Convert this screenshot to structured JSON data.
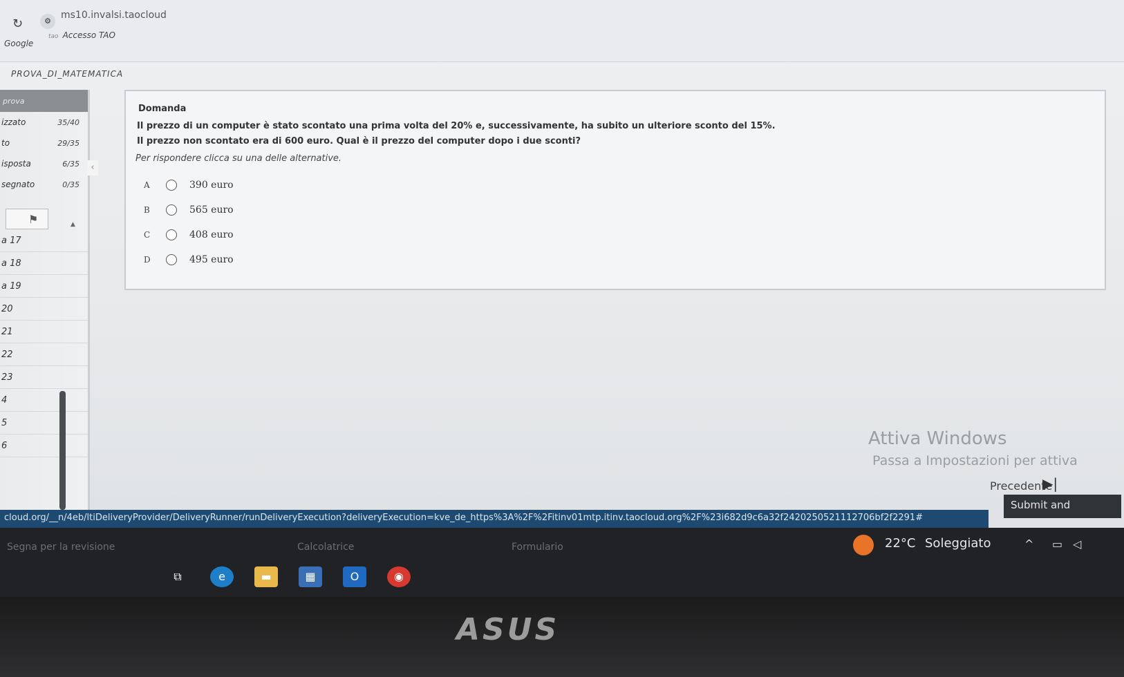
{
  "browser": {
    "url": "ms10.invalsi.taocloud",
    "bookmarks": [
      {
        "label": "Google"
      },
      {
        "label": "Accesso TAO",
        "icon_text": "tao"
      }
    ]
  },
  "app": {
    "title": "PROVA_DI_MATEMATICA"
  },
  "sidebar": {
    "header": "prova",
    "stats": [
      {
        "label": "izzato",
        "value": "35/40"
      },
      {
        "label": "to",
        "value": "29/35"
      },
      {
        "label": "isposta",
        "value": "6/35"
      },
      {
        "label": "segnato",
        "value": "0/35"
      }
    ],
    "items": [
      "a 17",
      "a 18",
      "a 19",
      "20",
      "21",
      "22",
      "23",
      "4",
      "5",
      "6"
    ]
  },
  "question": {
    "label": "Domanda",
    "text_line1": "Il prezzo di un computer è stato scontato una prima volta del 20% e, successivamente, ha subito un ulteriore sconto del 15%.",
    "text_line2": "Il prezzo non scontato era di 600 euro. Qual è il prezzo del computer dopo i due sconti?",
    "instruction": "Per rispondere clicca su una delle alternative.",
    "options": [
      {
        "letter": "A",
        "text": "390 euro"
      },
      {
        "letter": "B",
        "text": "565 euro"
      },
      {
        "letter": "C",
        "text": "408 euro"
      },
      {
        "letter": "D",
        "text": "495 euro"
      }
    ]
  },
  "watermark": {
    "title": "Attiva Windows",
    "subtitle": "Passa a Impostazioni per attiva"
  },
  "status_url": "cloud.org/__n/4eb/ltiDeliveryProvider/DeliveryRunner/runDeliveryExecution?deliveryExecution=kve_de_https%3A%2F%2Fitinv01mtp.itinv.taocloud.org%2F%23i682d9c6a32f2420250521112706bf2f2291#",
  "toolbar": {
    "prev_label": "Precedente",
    "submit_label": "Submit and",
    "faded": [
      "Segna per la revisione",
      "Calcolatrice",
      "Formulario"
    ]
  },
  "taskbar": {
    "temperature": "22°C",
    "weather": "Soleggiato"
  },
  "bezel": {
    "brand": "ASUS"
  }
}
